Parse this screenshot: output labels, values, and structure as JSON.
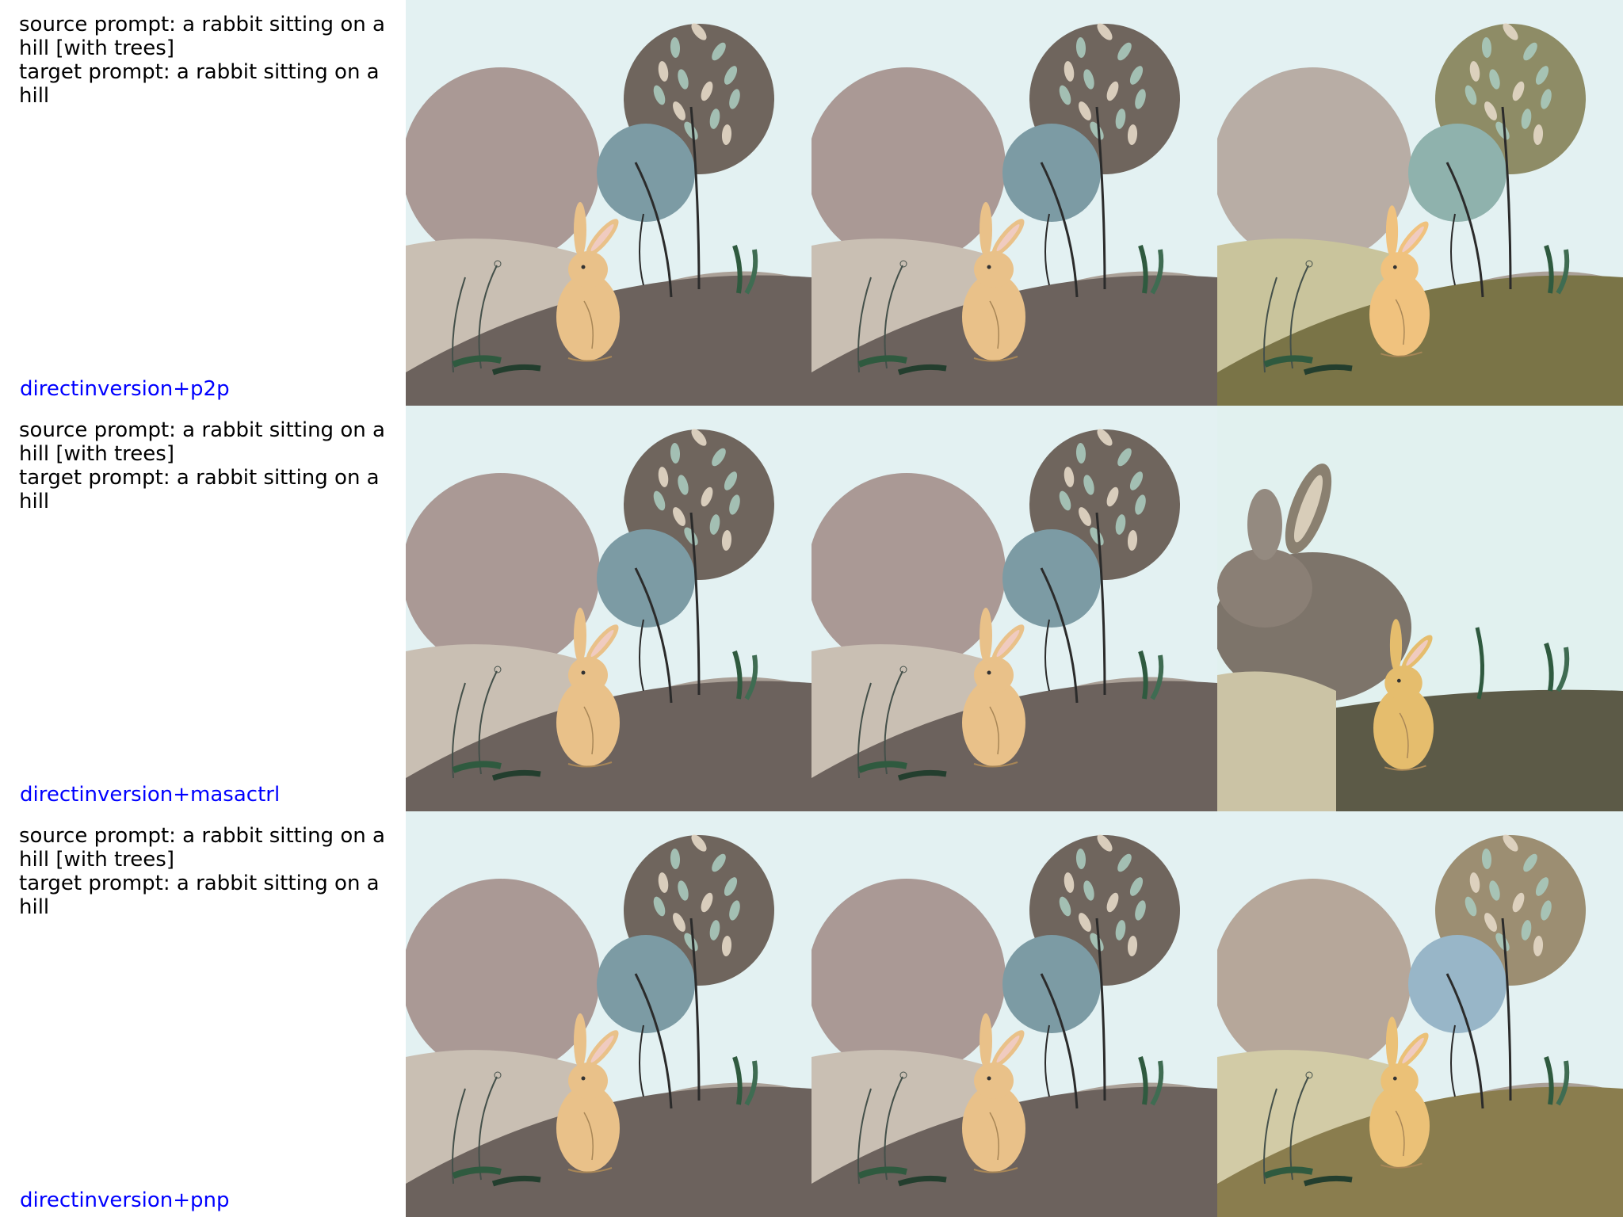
{
  "rows": [
    {
      "source_prompt": "source prompt: a rabbit sitting on a hill [with trees]",
      "target_prompt": "target prompt: a rabbit sitting on a hill",
      "method": "directinversion+p2p"
    },
    {
      "source_prompt": "source prompt: a rabbit sitting on a hill [with trees]",
      "target_prompt": "target prompt: a rabbit sitting on a hill",
      "method": "directinversion+masactrl"
    },
    {
      "source_prompt": "source prompt: a rabbit sitting on a hill [with trees]",
      "target_prompt": "target prompt: a rabbit sitting on a hill",
      "method": "directinversion+pnp"
    }
  ],
  "colors": {
    "method_label": "#0000ff",
    "sky": "#e3f1f2",
    "big_moon": "#a38f8b",
    "tree_disc": "#6f655d",
    "blue_disc": "#7c9ba4",
    "hill_dark": "#6c625d",
    "hill_light": "#c9bfb3",
    "rabbit": "#e9c189",
    "leaf": "#a9c9bd",
    "olive_hill": "#7a7447",
    "olive_disc": "#8e8c66"
  },
  "icons": [
    "illustration-rabbit-hill"
  ]
}
